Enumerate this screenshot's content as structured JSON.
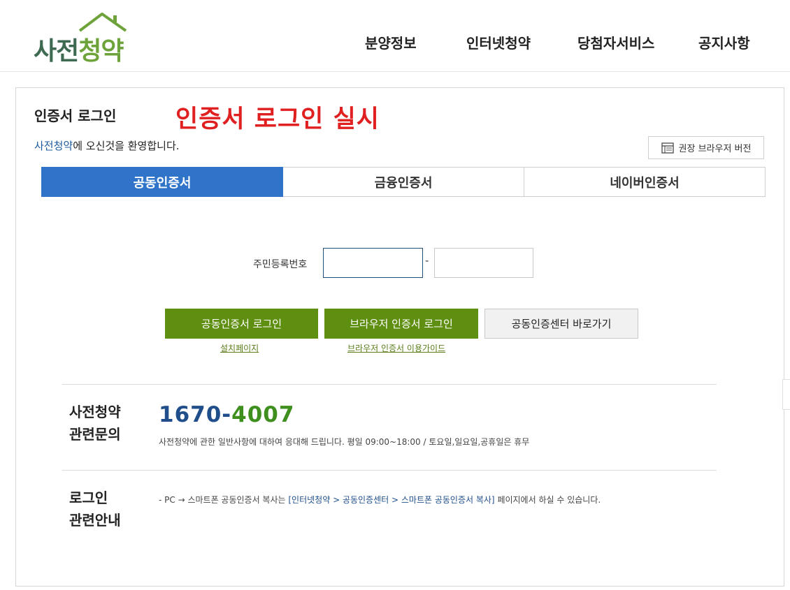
{
  "header": {
    "logo": {
      "part1": "사전",
      "part2": "청약"
    },
    "nav": [
      {
        "label": "분양정보"
      },
      {
        "label": "인터넷청약"
      },
      {
        "label": "당첨자서비스"
      },
      {
        "label": "공지사항"
      }
    ]
  },
  "login": {
    "title": "인증서 로그인",
    "notice": "인증서 로그인 실시",
    "welcome_highlight": "사전청약",
    "welcome_rest": "에 오신것을 환영합니다.",
    "browser_button": "권장 브라우저 버전",
    "tabs": [
      {
        "label": "공동인증서",
        "active": true
      },
      {
        "label": "금융인증서",
        "active": false
      },
      {
        "label": "네이버인증서",
        "active": false
      }
    ],
    "ssn_label": "주민등록번호",
    "ssn_separator": "-",
    "ssn_first_value": "",
    "ssn_second_value": "",
    "buttons": {
      "joint_cert_login": "공동인증서 로그인",
      "browser_cert_login": "브라우저 인증서 로그인",
      "cert_center": "공동인증센터 바로가기"
    },
    "links": {
      "install_page": "설치페이지",
      "browser_cert_guide": "브라우저 인증서 이용가이드"
    }
  },
  "inquiry": {
    "heading_line1": "사전청약",
    "heading_line2": "관련문의",
    "phone_part1": "1670",
    "phone_sep": "-",
    "phone_part2": "4007",
    "description": "사전청약에 관한 일반사항에 대하여 응대해 드립니다. 평일 09:00~18:00  /  토요일,일요일,공휴일은 휴무"
  },
  "login_guide": {
    "heading_line1": "로그인",
    "heading_line2": "관련안내",
    "text_before": "- PC → 스마트폰 공동인증서 복사는 ",
    "path": "[인터넷청약 > 공동인증센터 > 스마트폰 공동인증서 복사]",
    "text_after": " 페이지에서 하실 수 있습니다."
  },
  "colors": {
    "tab_active": "#2f74c9",
    "button_green": "#5f8f10",
    "notice_red": "#e02020",
    "logo_dark_green": "#3f6a52",
    "logo_light_green": "#6da33a",
    "phone_blue": "#1f4e8a",
    "phone_green": "#3f8f1f"
  }
}
